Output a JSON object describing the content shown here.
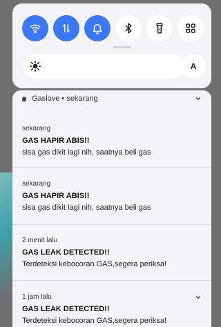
{
  "quick_settings": {
    "tiles": [
      {
        "name": "wifi-tile",
        "icon": "wifi-icon",
        "state": "on"
      },
      {
        "name": "mobile-data-tile",
        "icon": "data-transfer-icon",
        "state": "on"
      },
      {
        "name": "notifications-tile",
        "icon": "bell-icon",
        "state": "on"
      },
      {
        "name": "bluetooth-tile",
        "icon": "bluetooth-icon",
        "state": "off"
      },
      {
        "name": "flashlight-tile",
        "icon": "flashlight-icon",
        "state": "off"
      },
      {
        "name": "more-tiles",
        "icon": "grid-icon",
        "state": "off"
      }
    ],
    "auto_brightness_label": "A",
    "accent_color": "#3b78f5"
  },
  "notifications": {
    "header": {
      "app_label": "Gaslove • sekarang"
    },
    "items": [
      {
        "time": "sekarang",
        "title": "GAS HAPIR ABIS!!",
        "body": "sisa gas dikit lagi nih, saatnya beli gas"
      },
      {
        "time": "sekarang",
        "title": "GAS HAPIR ABIS!!",
        "body": "sisa gas dikit lagi nih, saatnya beli gas"
      },
      {
        "time": "2 menit lalu",
        "title": "GAS LEAK DETECTED!!",
        "body": "Terdeteksi kebocoran GAS,segera periksa!"
      },
      {
        "time": "1 jam lalu",
        "title": "GAS LEAK DETECTED!!",
        "body": "Terdeteksi kebocoran GAS,segera periksa!"
      }
    ]
  }
}
